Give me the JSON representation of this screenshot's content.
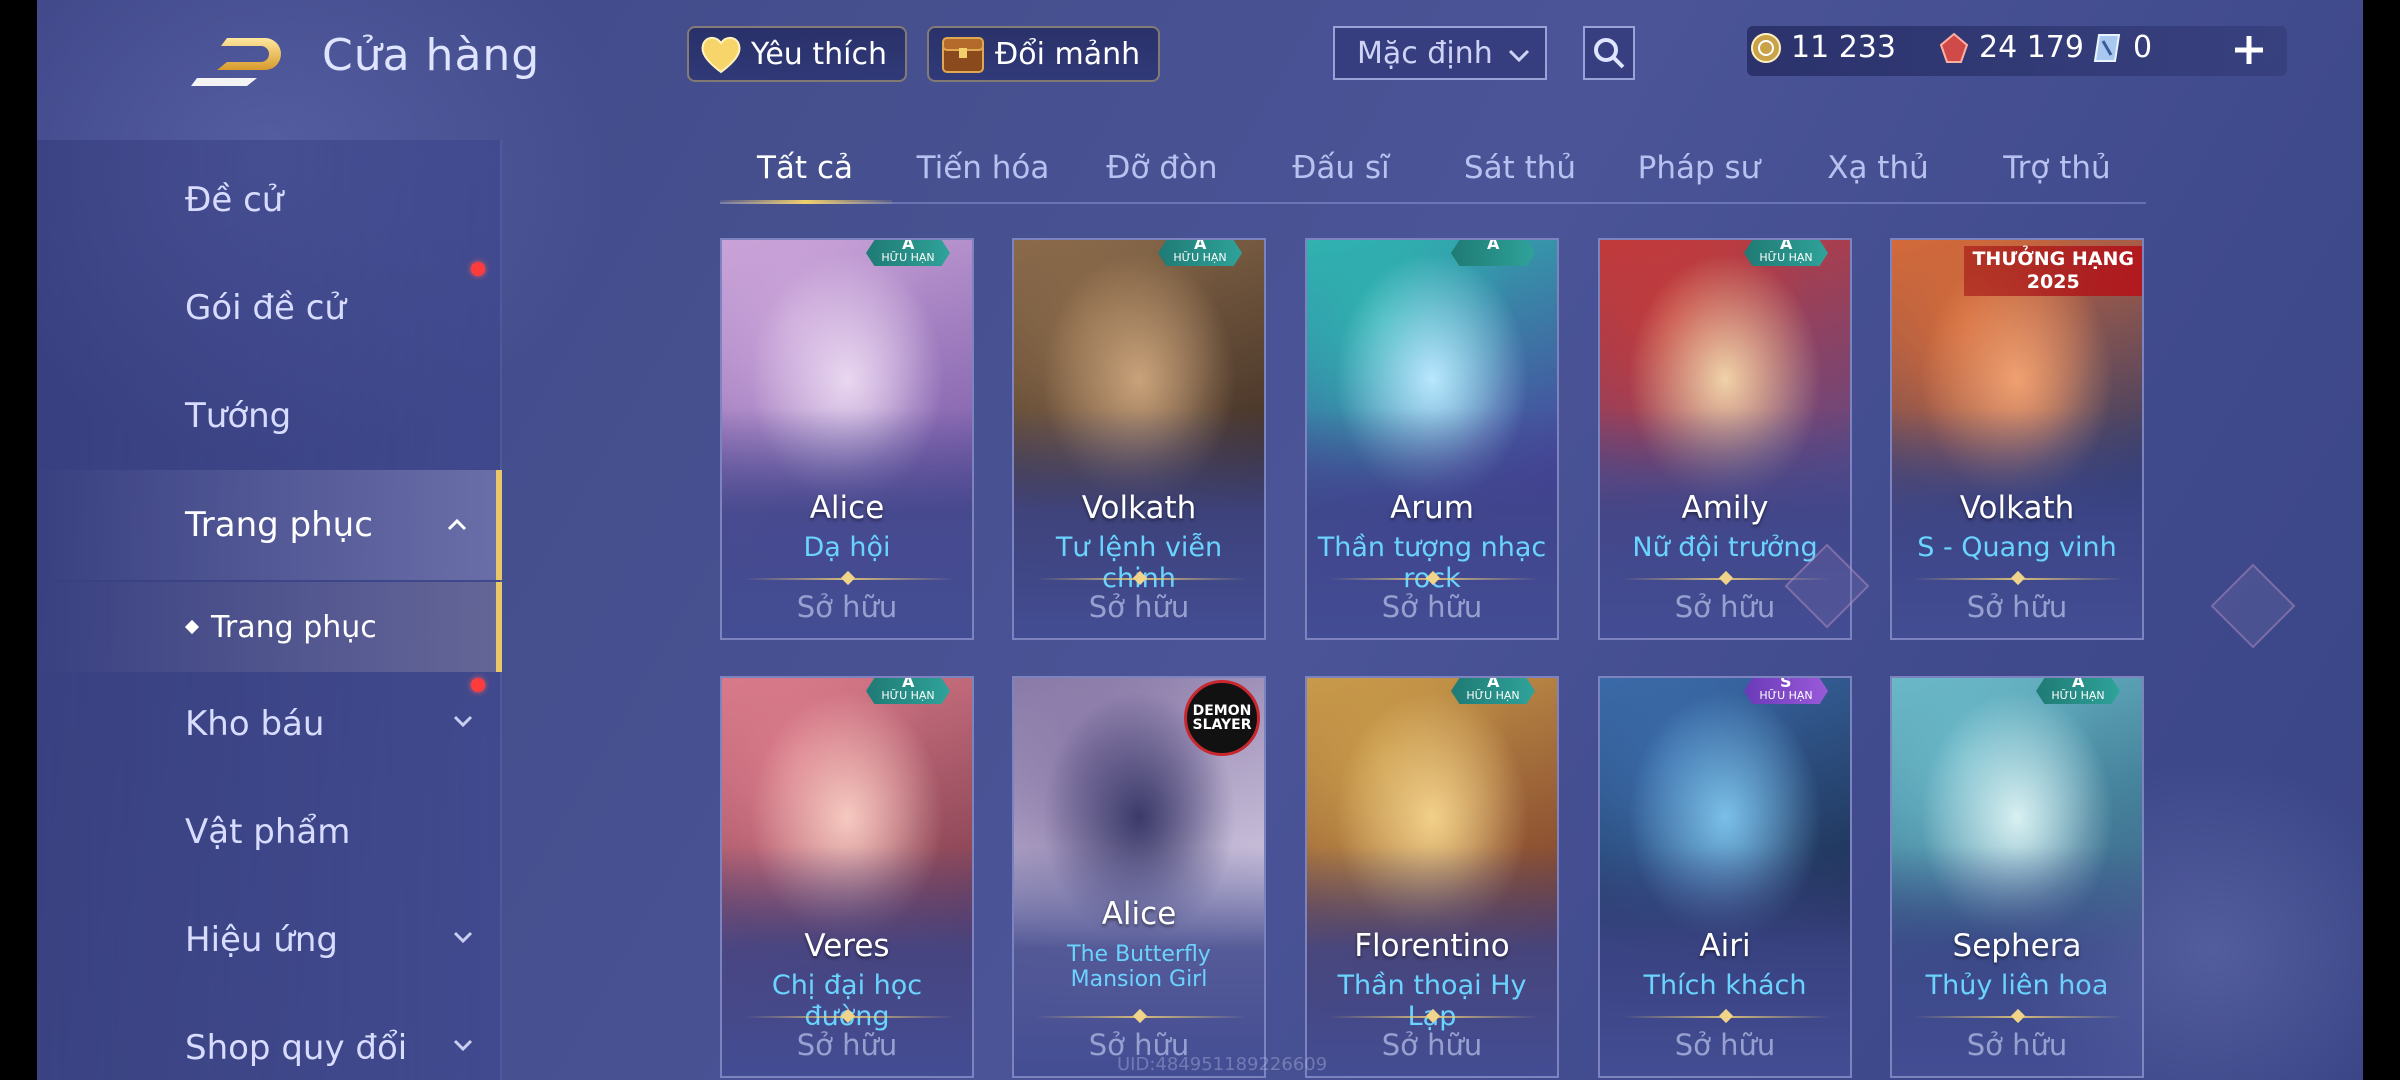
{
  "header": {
    "title": "Cửa hàng"
  },
  "sidebar": {
    "items": [
      {
        "label": "Đề cử"
      },
      {
        "label": "Gói đề cử"
      },
      {
        "label": "Tướng"
      },
      {
        "label": "Trang phục"
      },
      {
        "label": "Kho báu"
      },
      {
        "label": "Vật phẩm"
      },
      {
        "label": "Hiệu ứng"
      },
      {
        "label": "Shop quy đổi"
      }
    ],
    "sub_item": {
      "label": "Trang phục"
    }
  },
  "topbar": {
    "favorite_label": "Yêu thích",
    "exchange_label": "Đổi mảnh",
    "sort_value": "Mặc định"
  },
  "currency": {
    "gold": "11 233",
    "voucher": "24 179",
    "diamond": "0"
  },
  "tabs": [
    "Tất cả",
    "Tiến hóa",
    "Đỡ đòn",
    "Đấu sĩ",
    "Sát thủ",
    "Pháp sư",
    "Xạ thủ",
    "Trợ thủ"
  ],
  "cards": [
    {
      "hero": "Alice",
      "skin": "Dạ hội",
      "status": "Sở hữu",
      "badge_text": "HỮU HẠN",
      "badge_rank": "A",
      "palette": [
        "#c9a3d8",
        "#7a5aa8",
        "#e9d7f0"
      ]
    },
    {
      "hero": "Volkath",
      "skin": "Tư lệnh viễn chinh",
      "status": "Sở hữu",
      "badge_text": "HỮU HẠN",
      "badge_rank": "A",
      "palette": [
        "#8a6a4a",
        "#3a2a22",
        "#c9a27a"
      ]
    },
    {
      "hero": "Arum",
      "skin": "Thần tượng nhạc rock",
      "status": "Sở hữu",
      "badge_text": "",
      "badge_rank": "A",
      "palette": [
        "#2fb3b0",
        "#4a3b9a",
        "#b9e7ff"
      ]
    },
    {
      "hero": "Amily",
      "skin": "Nữ đội trưởng",
      "status": "Sở hữu",
      "badge_text": "HỮU HẠN",
      "badge_rank": "A",
      "palette": [
        "#c23a3a",
        "#5a4a8a",
        "#f0d2a8"
      ]
    },
    {
      "hero": "Volkath",
      "skin": "S - Quang vinh",
      "status": "Sở hữu",
      "badge_text": "",
      "badge_rank": "",
      "corner_label_line1": "THƯỞNG HẠNG",
      "corner_label_line2": "2025",
      "palette": [
        "#d46a3a",
        "#2a3a6a",
        "#f0a070"
      ]
    },
    {
      "hero": "Veres",
      "skin": "Chị đại học đường",
      "status": "Sở hữu",
      "badge_text": "HỮU HẠN",
      "badge_rank": "A",
      "palette": [
        "#d97a8a",
        "#7a3a4a",
        "#f6c9c0"
      ]
    },
    {
      "hero": "Alice",
      "skin": "The Butterfly Mansion Girl",
      "status": "Sở hữu",
      "badge_text": "",
      "badge_rank": "",
      "collab_logo": "DEMON SLAYER",
      "palette": [
        "#8a7aa8",
        "#d9d0e6",
        "#3a3a6a"
      ]
    },
    {
      "hero": "Florentino",
      "skin": "Thần thoại Hy Lạp",
      "status": "Sở hữu",
      "badge_text": "HỮU HẠN",
      "badge_rank": "A",
      "palette": [
        "#c89a4a",
        "#7a3a2a",
        "#f2d08a"
      ]
    },
    {
      "hero": "Airi",
      "skin": "Thích khách",
      "status": "Sở hữu",
      "badge_text": "HỮU HẠN",
      "badge_rank": "S",
      "palette": [
        "#3a6aa8",
        "#1a2a4a",
        "#7ac0e8"
      ]
    },
    {
      "hero": "Sephera",
      "skin": "Thủy liên hoa",
      "status": "Sở hữu",
      "badge_text": "HỮU HẠN",
      "badge_rank": "A",
      "palette": [
        "#6ab8c8",
        "#2a5a7a",
        "#d8f0f2"
      ]
    }
  ],
  "watermark": "UID:484951189226609",
  "colors": {
    "accent_gold": "#e9c86a",
    "skin_text": "#6ad4ff",
    "notification": "#ff3b3b"
  }
}
